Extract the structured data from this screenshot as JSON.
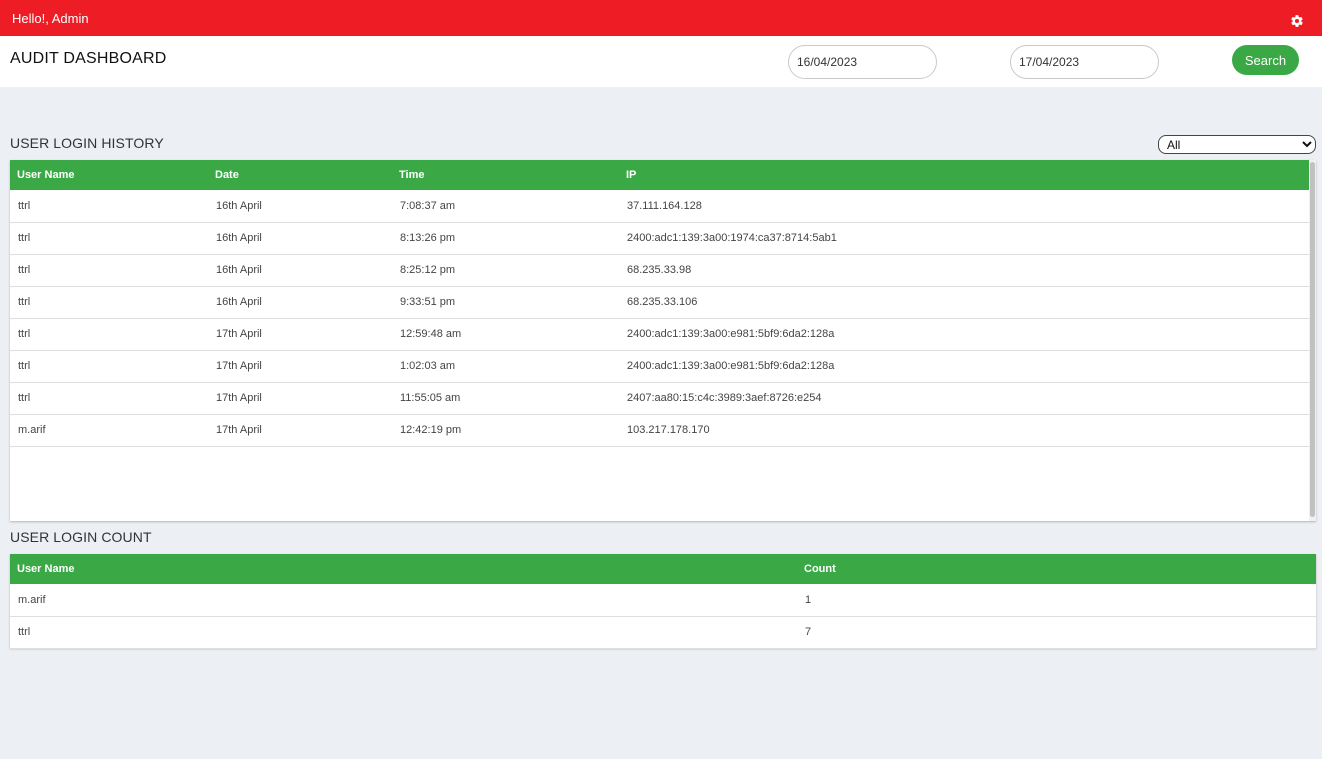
{
  "topbar": {
    "greeting": "Hello!, Admin",
    "settings_icon": "gear-icon",
    "color": "#ee1c25"
  },
  "header": {
    "title": "AUDIT DASHBOARD",
    "date_from": "16/04/2023",
    "date_to": "17/04/2023",
    "search_label": "Search"
  },
  "history": {
    "title": "USER LOGIN HISTORY",
    "filter_selected": "All",
    "columns": [
      "User Name",
      "Date",
      "Time",
      "IP"
    ],
    "rows": [
      [
        "ttrl",
        "16th April",
        "7:08:37 am",
        "37.111.164.128"
      ],
      [
        "ttrl",
        "16th April",
        "8:13:26 pm",
        "2400:adc1:139:3a00:1974:ca37:8714:5ab1"
      ],
      [
        "ttrl",
        "16th April",
        "8:25:12 pm",
        "68.235.33.98"
      ],
      [
        "ttrl",
        "16th April",
        "9:33:51 pm",
        "68.235.33.106"
      ],
      [
        "ttrl",
        "17th April",
        "12:59:48 am",
        "2400:adc1:139:3a00:e981:5bf9:6da2:128a"
      ],
      [
        "ttrl",
        "17th April",
        "1:02:03 am",
        "2400:adc1:139:3a00:e981:5bf9:6da2:128a"
      ],
      [
        "ttrl",
        "17th April",
        "11:55:05 am",
        "2407:aa80:15:c4c:3989:3aef:8726:e254"
      ],
      [
        "m.arif",
        "17th April",
        "12:42:19 pm",
        "103.217.178.170"
      ]
    ]
  },
  "count": {
    "title": "USER LOGIN COUNT",
    "columns": [
      "User Name",
      "Count"
    ],
    "rows": [
      [
        "m.arif",
        "1"
      ],
      [
        "ttrl",
        "7"
      ]
    ]
  },
  "colors": {
    "accent": "#39a845",
    "topbar": "#ee1c25",
    "background": "#eceff4"
  }
}
